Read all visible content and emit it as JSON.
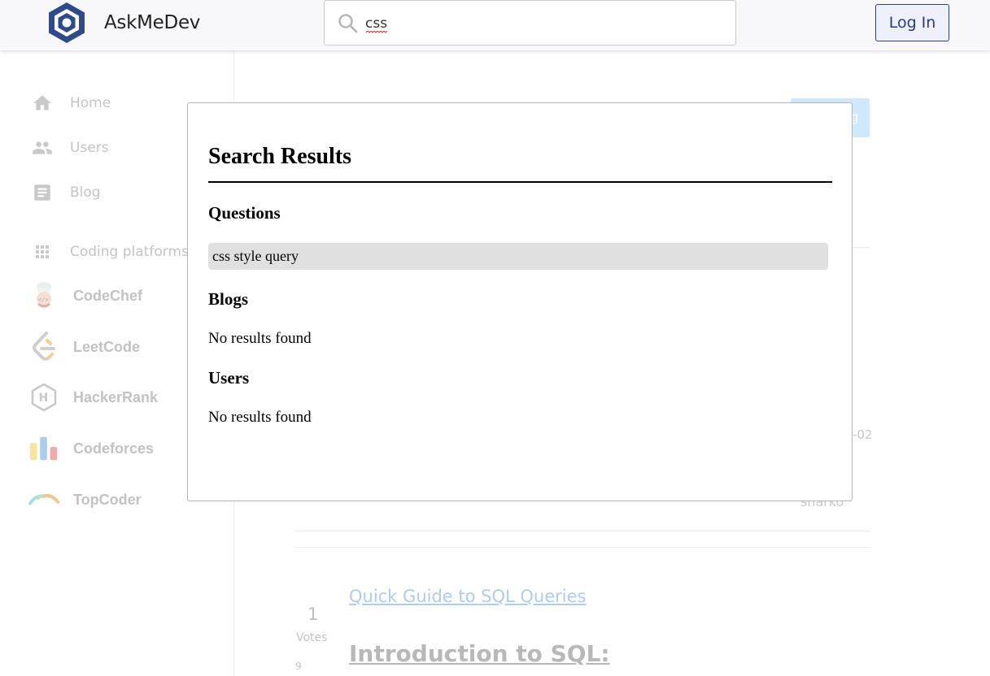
{
  "header": {
    "brand": "AskMeDev",
    "search_value": "css",
    "login_label": "Log In"
  },
  "sidebar": {
    "nav": [
      {
        "label": "Home",
        "icon": "home-icon"
      },
      {
        "label": "Users",
        "icon": "users-icon"
      },
      {
        "label": "Blog",
        "icon": "blog-icon"
      }
    ],
    "platforms_label": "Coding platforms :",
    "platforms": [
      {
        "label": "CodeChef",
        "icon": "codechef-icon"
      },
      {
        "label": "LeetCode",
        "icon": "leetcode-icon"
      },
      {
        "label": "HackerRank",
        "icon": "hackerrank-icon"
      },
      {
        "label": "Codeforces",
        "icon": "codeforces-icon"
      },
      {
        "label": "TopCoder",
        "icon": "topcoder-icon"
      }
    ]
  },
  "background": {
    "ghost_button": "g",
    "date_fragment": "-02",
    "user_fragment": "sharko",
    "votes_count": "1",
    "votes_label": "Votes",
    "answers_count": "9",
    "post_link": "Quick Guide to SQL Queries",
    "post_heading": "Introduction to SQL:"
  },
  "modal": {
    "title": "Search Results",
    "questions_heading": "Questions",
    "question_results": [
      "css style query"
    ],
    "blogs_heading": "Blogs",
    "blogs_empty": "No results found",
    "users_heading": "Users",
    "users_empty": "No results found"
  },
  "colors": {
    "brand_primary": "#2f4a8a",
    "login_border": "#2f3d8a",
    "result_highlight": "#e0e0e0",
    "link_faded": "#aecbf3"
  }
}
